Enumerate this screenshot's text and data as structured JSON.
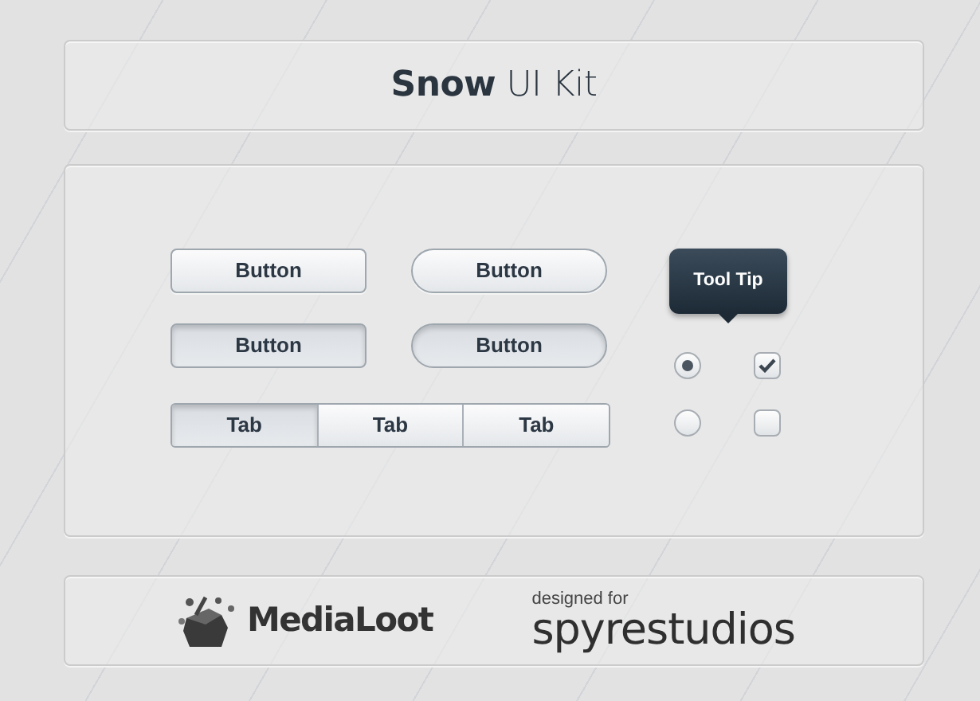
{
  "header": {
    "title": "**Snow** UI Kit"
  },
  "buttons": [
    {
      "label": "Button",
      "kind": "rounded",
      "pressed": false
    },
    {
      "label": "Button",
      "kind": "pill",
      "pressed": false
    },
    {
      "label": "Button",
      "kind": "rounded",
      "pressed": true
    },
    {
      "label": "Button",
      "kind": "pill",
      "pressed": true
    }
  ],
  "tabs": [
    {
      "label": "Tab",
      "selected": true
    },
    {
      "label": "Tab",
      "selected": false
    },
    {
      "label": "Tab",
      "selected": false
    }
  ],
  "tooltip": {
    "text": "Tool Tip"
  },
  "radios": [
    {
      "selected": true
    },
    {
      "selected": false
    }
  ],
  "checkboxes": [
    {
      "checked": true
    },
    {
      "checked": false
    }
  ],
  "footer": {
    "brand": "MediaLoot",
    "credit_caption": "designed for",
    "credit_name": "spyrestudios"
  }
}
